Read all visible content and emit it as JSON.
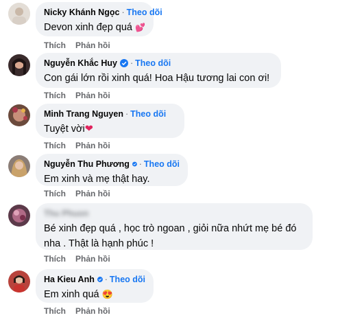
{
  "comments": [
    {
      "name": "Nicky Khánh Ngọc",
      "verified": false,
      "dot": "·",
      "follow": "Theo dõi",
      "text": "Devon xinh đẹp quá",
      "emoji": "💕",
      "like": "Thích",
      "reply": "Phản hồi"
    },
    {
      "name": "Nguyễn Khắc Huy",
      "verified": true,
      "dot": "·",
      "follow": "Theo dõi",
      "text": "Con gái lớn rồi xinh quá! Hoa Hậu tương lai con ơi!",
      "like": "Thích",
      "reply": "Phản hồi"
    },
    {
      "name": "Minh Trang Nguyen",
      "verified": false,
      "dot": "·",
      "follow": "Theo dõi",
      "text": "Tuyệt vời",
      "emoji": "❤",
      "like": "Thích",
      "reply": "Phản hồi"
    },
    {
      "name": "Nguyễn Thu Phương",
      "verified": true,
      "dot": "·",
      "follow": "Theo dõi",
      "text": "Em xinh và mẹ thật hay.",
      "like": "Thích",
      "reply": "Phản hồi"
    },
    {
      "name": "Thu Phuon",
      "verified": false,
      "blurred": true,
      "text": "Bé xinh đẹp quá , học trò ngoan , giỏi nữa nhứt mẹ bé đó nha . Thật là hạnh phúc !",
      "like": "Thích",
      "reply": "Phản hồi"
    },
    {
      "name": "Ha Kieu Anh",
      "verified": true,
      "dot": "·",
      "follow": "Theo dõi",
      "text": "Em xinh quá",
      "emoji": "😍",
      "like": "Thích",
      "reply": "Phản hồi"
    }
  ],
  "colors": {
    "bubble": "#f0f2f5",
    "link": "#1877f2",
    "muted": "#65676b",
    "verified": "#1877f2"
  },
  "icons": [
    "verified-badge-icon",
    "avatar"
  ]
}
